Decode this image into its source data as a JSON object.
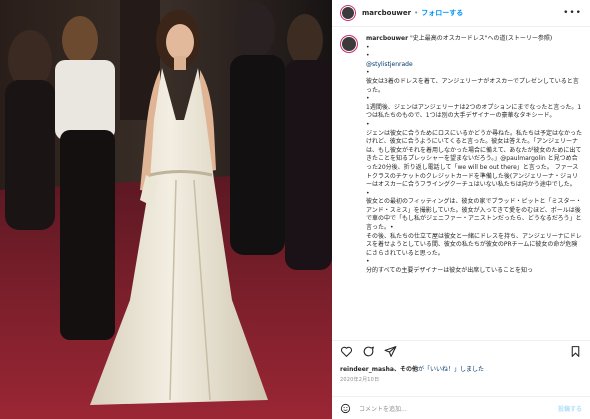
{
  "post": {
    "username": "marcbouwer",
    "follow_label": "フォローする",
    "more_icon": "more-options-icon"
  },
  "caption": {
    "username": "marcbouwer",
    "lines": [
      "\"史上最高のオスカードレス\"への道(ストーリー参照)",
      "•",
      "•",
      "@stylistjenrade",
      "•",
      "彼女は3着のドレスを着て、アンジェリーナがオスカーでプレゼンしていると言った。",
      "•",
      "1週間後、ジェンはアンジェリーナは2つのオプションにまでなったと言った。1つは私たちのもので、1つは別の大手デザイナーの豪華なタキシード。",
      "•",
      "ジェンは彼女に合うためにロスにいるかどうか尋ねた。私たちは予定はなかったけれど、彼女に合うようにいてくると言った。彼女は答えた。「アンジェリーナは、もし彼女がそれを着用しなかった場合に備えて、あなたが彼女のために出てきたことを知るプレッシャーを望まないだろう。」@paulmargolin と見つめ合った20分後、折り返し電話して「we will be out there」と言った。 ファーストクラスのチケットのクレジットカードを準備した後(アンジェリーナ・ジョリーはオスカーに合うフライングクーチュはいない私たちは向かう途中でした。",
      "•",
      "彼女との最初のフィッティングは、彼女の家でブラッド・ピットと「ミスター・アンド・スミス」を撮影していた。彼女が入ってきて愛をのむほど、ポールは後で車の中で「もし私がジェニファー・アニストンだったら、どうなるだろう」と言った。•",
      "その後、私たちの仕立て屋は彼女と一緒にドレスを持ち、アンジェリーナにドレスを着せようとしている間、彼女の私たちが彼女のPRチームに彼女の命が危険にさらされていると思った。",
      "•",
      "分的すべての主要デザイナーは彼女が出席していることを知っ"
    ],
    "mention": "@stylistjenrade"
  },
  "actions": {
    "like_icon": "heart-icon",
    "comment_icon": "comment-icon",
    "share_icon": "share-icon",
    "save_icon": "bookmark-icon"
  },
  "likes": {
    "user": "reindeer_masha",
    "middle": "、その他",
    "link": "が「いいね！」しました"
  },
  "date": "2020年2月10日",
  "comment_box": {
    "placeholder": "コメントを追加...",
    "post_label": "投稿する"
  }
}
